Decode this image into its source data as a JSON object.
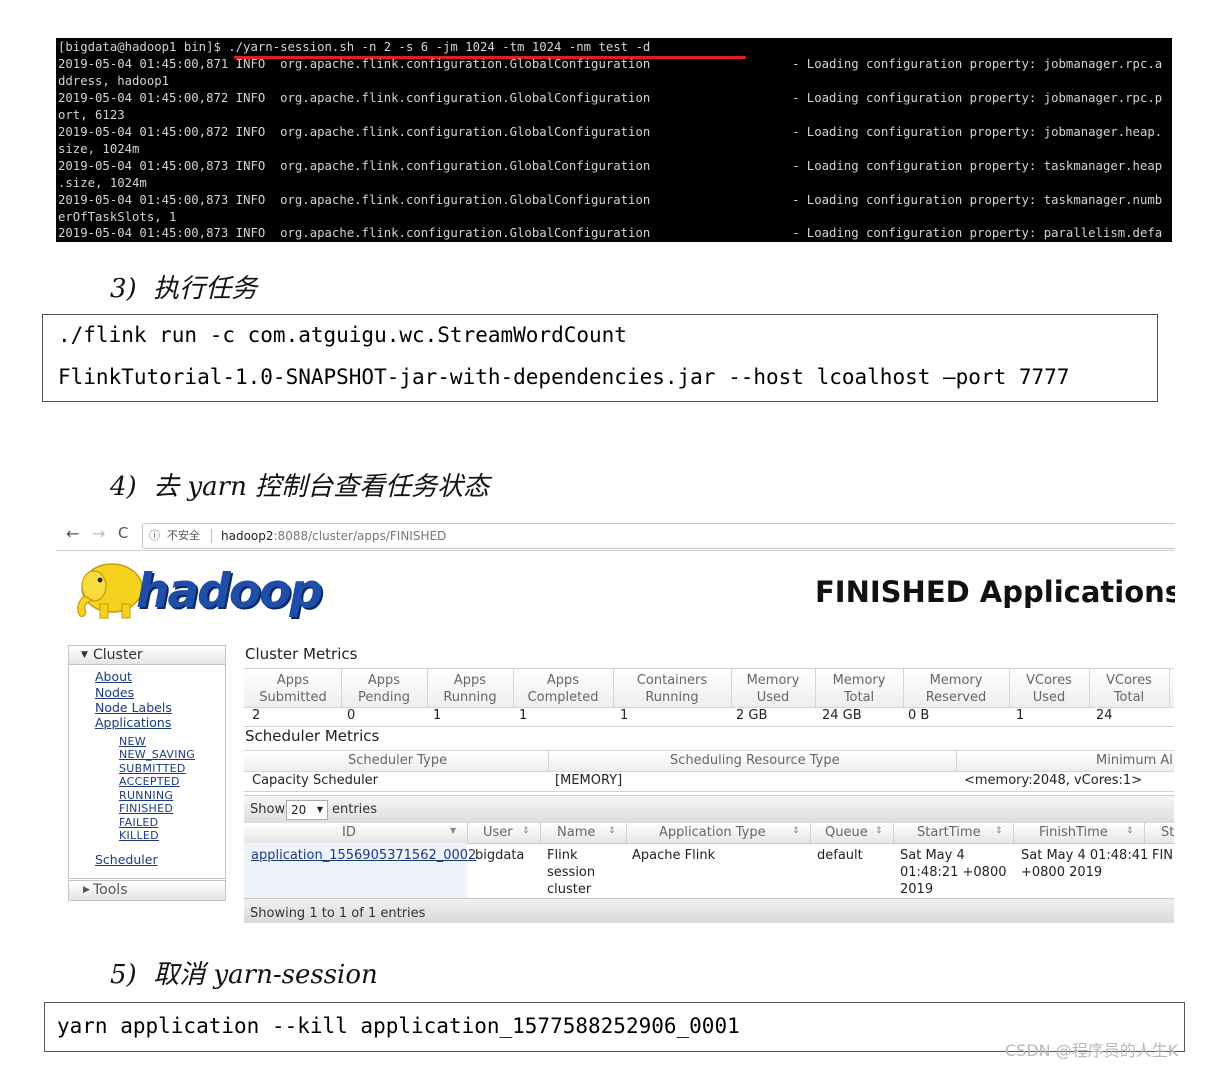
{
  "terminal": {
    "lines": [
      {
        "left": "[bigdata@hadoop1 bin]$ ./yarn-session.sh -n 2 -s 6 -jm 1024 -tm 1024 -nm test -d",
        "right": ""
      },
      {
        "left": "2019-05-04 01:45:00,871 INFO  org.apache.flink.configuration.GlobalConfiguration",
        "right": "- Loading configuration property: jobmanager.rpc.a"
      },
      {
        "left": "ddress, hadoop1",
        "right": ""
      },
      {
        "left": "2019-05-04 01:45:00,872 INFO  org.apache.flink.configuration.GlobalConfiguration",
        "right": "- Loading configuration property: jobmanager.rpc.p"
      },
      {
        "left": "ort, 6123",
        "right": ""
      },
      {
        "left": "2019-05-04 01:45:00,872 INFO  org.apache.flink.configuration.GlobalConfiguration",
        "right": "- Loading configuration property: jobmanager.heap."
      },
      {
        "left": "size, 1024m",
        "right": ""
      },
      {
        "left": "2019-05-04 01:45:00,873 INFO  org.apache.flink.configuration.GlobalConfiguration",
        "right": "- Loading configuration property: taskmanager.heap"
      },
      {
        "left": ".size, 1024m",
        "right": ""
      },
      {
        "left": "2019-05-04 01:45:00,873 INFO  org.apache.flink.configuration.GlobalConfiguration",
        "right": "- Loading configuration property: taskmanager.numb"
      },
      {
        "left": "erOfTaskSlots, 1",
        "right": ""
      },
      {
        "left": "2019-05-04 01:45:00,873 INFO  org.apache.flink.configuration.GlobalConfiguration",
        "right": "- Loading configuration property: parallelism.defa"
      }
    ]
  },
  "step3": {
    "heading": "3)  执行任务",
    "code": [
      "./flink run -c com.atguigu.wc.StreamWordCount",
      "FlinkTutorial-1.0-SNAPSHOT-jar-with-dependencies.jar --host lcoalhost –port 7777"
    ]
  },
  "step4": {
    "heading": "4)  去 yarn 控制台查看任务状态"
  },
  "browser": {
    "back": "←",
    "forward": "→",
    "reload": "C",
    "info_icon": "ⓘ",
    "insecure": "不安全",
    "host": "hadoop2",
    "path": ":8088/cluster/apps/FINISHED"
  },
  "hadoop": {
    "logo_text": "hadoop",
    "page_title": "FINISHED Applications",
    "sidebar": {
      "cluster_label": "Cluster",
      "links": [
        "About",
        "Nodes",
        "Node Labels",
        "Applications"
      ],
      "app_states": [
        "NEW",
        "NEW_SAVING",
        "SUBMITTED",
        "ACCEPTED",
        "RUNNING",
        "FINISHED",
        "FAILED",
        "KILLED"
      ],
      "scheduler": "Scheduler",
      "tools_label": "Tools"
    },
    "cluster_metrics": {
      "title": "Cluster Metrics",
      "headers": [
        [
          "Apps",
          "Submitted"
        ],
        [
          "Apps",
          "Pending"
        ],
        [
          "Apps",
          "Running"
        ],
        [
          "Apps",
          "Completed"
        ],
        [
          "Containers",
          "Running"
        ],
        [
          "Memory",
          "Used"
        ],
        [
          "Memory",
          "Total"
        ],
        [
          "Memory",
          "Reserved"
        ],
        [
          "VCores",
          "Used"
        ],
        [
          "VCores",
          "Total"
        ]
      ],
      "values": [
        "2",
        "0",
        "1",
        "1",
        "1",
        "2 GB",
        "24 GB",
        "0 B",
        "1",
        "24"
      ]
    },
    "scheduler_metrics": {
      "title": "Scheduler Metrics",
      "headers": [
        "Scheduler Type",
        "Scheduling Resource Type",
        "Minimum Al"
      ],
      "values": [
        "Capacity Scheduler",
        "[MEMORY]",
        "<memory:2048, vCores:1>"
      ]
    },
    "apps_table": {
      "show_label": "Show",
      "show_value": "20",
      "entries_label": "entries",
      "columns": [
        "ID",
        "User",
        "Name",
        "Application Type",
        "Queue",
        "StartTime",
        "FinishTime",
        "St"
      ],
      "row": {
        "id": "application_1556905371562_0002",
        "user": "bigdata",
        "name": [
          "Flink",
          "session",
          "cluster"
        ],
        "type": "Apache Flink",
        "queue": "default",
        "start": [
          "Sat May 4",
          "01:48:21 +0800",
          "2019"
        ],
        "finish": [
          "Sat May 4 01:48:41",
          "+0800 2019"
        ],
        "state": "FIN"
      },
      "showing": "Showing 1 to 1 of 1 entries"
    }
  },
  "step5": {
    "heading": "5)  取消 yarn-session",
    "code": "yarn application --kill application_1577588252906_0001"
  },
  "watermark": "CSDN @程序员的人生K",
  "colors": {
    "underline_red": "#e01e1e",
    "link_blue": "#1a3a80",
    "logo_yellow": "#f5d21e",
    "logo_blue": "#1f4ea8"
  }
}
